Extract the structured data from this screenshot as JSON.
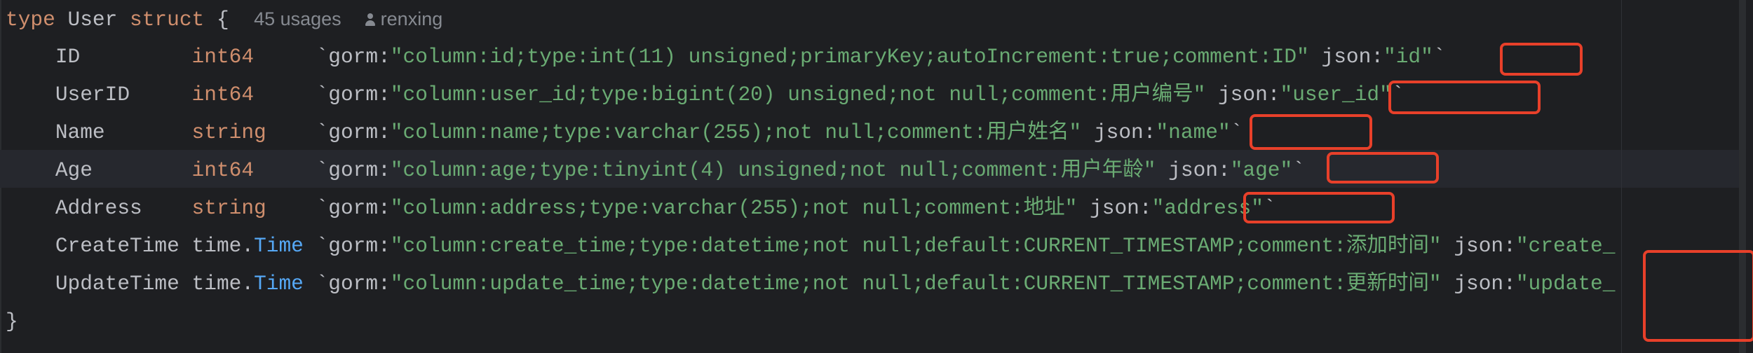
{
  "colors": {
    "background": "#1e1f22",
    "keyword": "#cf8e6d",
    "string": "#6aab73",
    "identifier": "#bcbec4",
    "hint": "#868a91",
    "highlight_box": "#e8402a"
  },
  "header": {
    "kw_type": "type",
    "name": "User",
    "kw_struct": "struct",
    "brace": "{",
    "usages": "45 usages",
    "author_icon": "person-icon",
    "author": "renxing"
  },
  "fields": [
    {
      "name": "ID         ",
      "type": "int64",
      "type_pkg": "",
      "tag_pre": "     `gorm:",
      "tag": "\"column:id;type:int(11) unsigned;primaryKey;autoIncrement:true;comment:ID\"",
      "json_pre": " json:",
      "json": "\"id\"",
      "tag_end": "`"
    },
    {
      "name": "UserID     ",
      "type": "int64",
      "type_pkg": "",
      "tag_pre": "     `gorm:",
      "tag": "\"column:user_id;type:bigint(20) unsigned;not null;comment:用户编号\"",
      "json_pre": " json:",
      "json": "\"user_id\"",
      "tag_end": "`"
    },
    {
      "name": "Name       ",
      "type": "string",
      "type_pkg": "",
      "tag_pre": "    `gorm:",
      "tag": "\"column:name;type:varchar(255);not null;comment:用户姓名\"",
      "json_pre": " json:",
      "json": "\"name\"",
      "tag_end": "`"
    },
    {
      "name": "Age        ",
      "type": "int64",
      "type_pkg": "",
      "tag_pre": "     `gorm:",
      "tag": "\"column:age;type:tinyint(4) unsigned;not null;comment:用户年龄\"",
      "json_pre": " json:",
      "json": "\"age\"",
      "tag_end": "`"
    },
    {
      "name": "Address    ",
      "type": "string",
      "type_pkg": "",
      "tag_pre": "    `gorm:",
      "tag": "\"column:address;type:varchar(255);not null;comment:地址\"",
      "json_pre": " json:",
      "json": "\"address\"",
      "tag_end": "`"
    },
    {
      "name": "CreateTime ",
      "type": "Time",
      "type_pkg": "time.",
      "tag_pre": " `gorm:",
      "tag": "\"column:create_time;type:datetime;not null;default:CURRENT_TIMESTAMP;comment:添加时间\"",
      "json_pre": " json:",
      "json": "\"create_",
      "tag_end": ""
    },
    {
      "name": "UpdateTime ",
      "type": "Time",
      "type_pkg": "time.",
      "tag_pre": " `gorm:",
      "tag": "\"column:update_time;type:datetime;not null;default:CURRENT_TIMESTAMP;comment:更新时间\"",
      "json_pre": " json:",
      "json": "\"update_",
      "tag_end": ""
    }
  ],
  "footer": {
    "brace": "}"
  }
}
